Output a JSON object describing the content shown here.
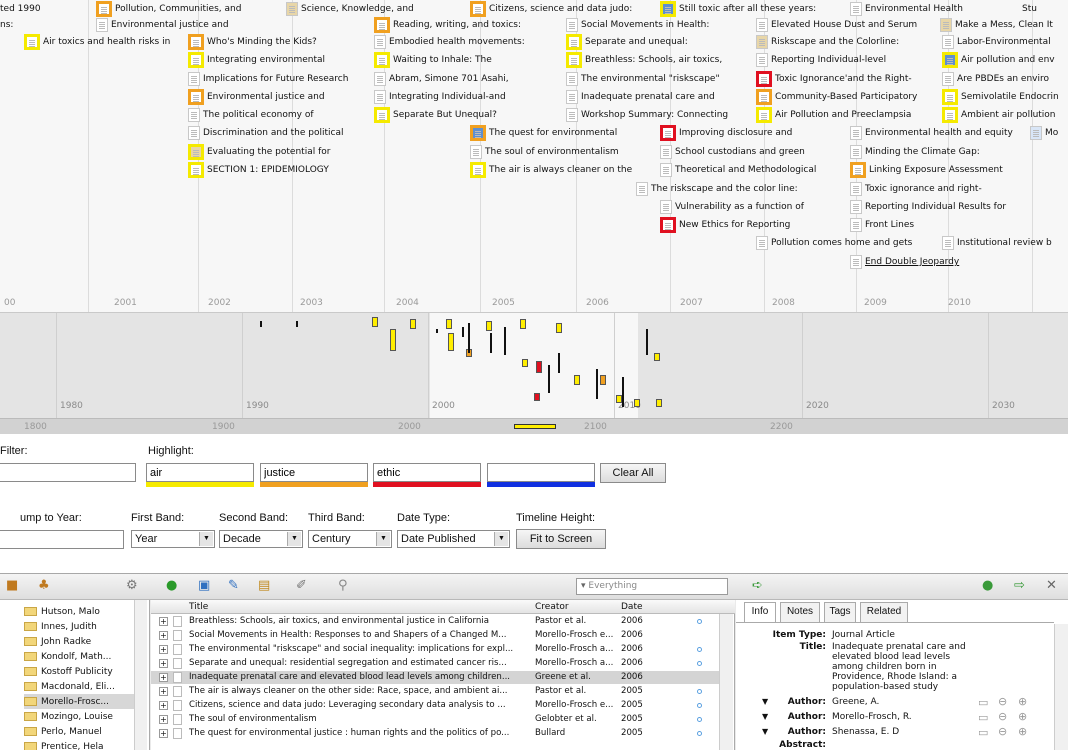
{
  "timeline": {
    "detail_years": [
      "00",
      "2001",
      "2002",
      "2003",
      "2004",
      "2005",
      "2006",
      "2007",
      "2008",
      "2009",
      "2010"
    ],
    "events": [
      {
        "label": "ted 1990",
        "h": "none",
        "k": "none"
      },
      {
        "label": "ns:",
        "h": "none",
        "k": "none"
      },
      {
        "label": "Air toxics and health risks in",
        "h": "air",
        "k": "doc"
      },
      {
        "label": "Pollution, Communities, and",
        "h": "just",
        "k": "doc"
      },
      {
        "label": "Environmental justice and",
        "h": "none",
        "k": "doc"
      },
      {
        "label": "Who's Minding the Kids?",
        "h": "just",
        "k": "doc"
      },
      {
        "label": "Integrating environmental",
        "h": "air",
        "k": "doc"
      },
      {
        "label": "Implications for Future Research",
        "h": "none",
        "k": "doc"
      },
      {
        "label": "Environmental justice and",
        "h": "just",
        "k": "doc"
      },
      {
        "label": "The political economy of",
        "h": "none",
        "k": "doc"
      },
      {
        "label": "Discrimination and the political",
        "h": "none",
        "k": "doc"
      },
      {
        "label": "Evaluating the potential for",
        "h": "air",
        "k": "img"
      },
      {
        "label": "SECTION 1: EPIDEMIOLOGY",
        "h": "air",
        "k": "doc"
      },
      {
        "label": "Science, Knowledge, and",
        "h": "none",
        "k": "img"
      },
      {
        "label": "Reading, writing, and toxics:",
        "h": "just",
        "k": "doc"
      },
      {
        "label": "Embodied health movements:",
        "h": "none",
        "k": "doc"
      },
      {
        "label": "Waiting to Inhale: The",
        "h": "air",
        "k": "doc"
      },
      {
        "label": "Abram, Simone 701 Asahi,",
        "h": "none",
        "k": "doc"
      },
      {
        "label": "Integrating Individual-and",
        "h": "none",
        "k": "doc"
      },
      {
        "label": "Separate But Unequal?",
        "h": "air",
        "k": "doc"
      },
      {
        "label": "Citizens, science and data judo:",
        "h": "just",
        "k": "doc"
      },
      {
        "label": "Social Movements in Health:",
        "h": "none",
        "k": "doc"
      },
      {
        "label": "Separate and unequal:",
        "h": "air",
        "k": "doc"
      },
      {
        "label": "Breathless: Schools, air toxics,",
        "h": "air",
        "k": "doc"
      },
      {
        "label": "The environmental \"riskscape\"",
        "h": "none",
        "k": "doc"
      },
      {
        "label": "Inadequate prenatal care and",
        "h": "none",
        "k": "doc"
      },
      {
        "label": "Workshop Summary: Connecting",
        "h": "none",
        "k": "doc"
      },
      {
        "label": "The quest for environmental",
        "h": "just",
        "k": "slide"
      },
      {
        "label": "The soul of environmentalism",
        "h": "none",
        "k": "doc"
      },
      {
        "label": "The air is always cleaner on the",
        "h": "air",
        "k": "doc"
      },
      {
        "label": "Still toxic after all these years:",
        "h": "air",
        "k": "slide"
      },
      {
        "label": "Elevated House Dust and Serum",
        "h": "none",
        "k": "doc"
      },
      {
        "label": "Riskscape and the Colorline:",
        "h": "none",
        "k": "img"
      },
      {
        "label": "Reporting Individual-level",
        "h": "none",
        "k": "doc"
      },
      {
        "label": "Toxic Ignorance'and the Right-",
        "h": "eth",
        "k": "doc"
      },
      {
        "label": "Community-Based Participatory",
        "h": "just",
        "k": "doc"
      },
      {
        "label": "Air Pollution and Preeclampsia",
        "h": "air",
        "k": "doc"
      },
      {
        "label": "Improving disclosure and",
        "h": "eth",
        "k": "doc"
      },
      {
        "label": "School custodians and green",
        "h": "none",
        "k": "doc"
      },
      {
        "label": "Theoretical and Methodological",
        "h": "none",
        "k": "doc"
      },
      {
        "label": "The riskscape and the color line:",
        "h": "none",
        "k": "doc"
      },
      {
        "label": "Vulnerability as a function of",
        "h": "none",
        "k": "doc"
      },
      {
        "label": "New Ethics for Reporting",
        "h": "eth",
        "k": "doc"
      },
      {
        "label": "Environmental Health",
        "h": "none",
        "k": "doc"
      },
      {
        "label": "Make a Mess, Clean It",
        "h": "none",
        "k": "img"
      },
      {
        "label": "Labor-Environmental",
        "h": "none",
        "k": "doc"
      },
      {
        "label": "Air pollution and env",
        "h": "air",
        "k": "slide"
      },
      {
        "label": "Are PBDEs an enviro",
        "h": "none",
        "k": "doc"
      },
      {
        "label": "Semivolatile Endocrin",
        "h": "air",
        "k": "doc"
      },
      {
        "label": "Ambient air pollution",
        "h": "air",
        "k": "doc"
      },
      {
        "label": "Environmental health and equity",
        "h": "none",
        "k": "doc"
      },
      {
        "label": "Minding the Climate Gap:",
        "h": "none",
        "k": "doc"
      },
      {
        "label": "Linking Exposure Assessment",
        "h": "just",
        "k": "doc"
      },
      {
        "label": "Toxic ignorance and right-",
        "h": "none",
        "k": "doc"
      },
      {
        "label": "Reporting Individual Results for",
        "h": "none",
        "k": "doc"
      },
      {
        "label": "Front Lines",
        "h": "none",
        "k": "doc"
      },
      {
        "label": "Pollution comes home and gets",
        "h": "none",
        "k": "doc"
      },
      {
        "label": "Institutional review b",
        "h": "none",
        "k": "doc"
      },
      {
        "label": "End Double Jeopardy",
        "h": "none",
        "k": "doc"
      },
      {
        "label": "Stu",
        "h": "air",
        "k": "none"
      },
      {
        "label": "Mo",
        "h": "none",
        "k": "book"
      }
    ],
    "overview_decades": [
      "1980",
      "1990",
      "2000",
      "2010",
      "2020",
      "2030"
    ],
    "centuries": [
      "1800",
      "1900",
      "2000",
      "2100",
      "2200"
    ]
  },
  "controls": {
    "filter_label": "Filter:",
    "highlight_label": "Highlight:",
    "highlights": [
      {
        "value": "air",
        "color": "#f5ea00"
      },
      {
        "value": "justice",
        "color": "#f0a020"
      },
      {
        "value": "ethic",
        "color": "#e01020"
      },
      {
        "value": "",
        "color": "#1030e0"
      }
    ],
    "clear_all": "Clear All",
    "jump_label": "ump to Year:",
    "first_band_label": "First Band:",
    "second_band_label": "Second Band:",
    "third_band_label": "Third Band:",
    "date_type_label": "Date Type:",
    "timeline_height_label": "Timeline Height:",
    "first_band": "Year",
    "second_band": "Decade",
    "third_band": "Century",
    "date_type": "Date Published",
    "fit_button": "Fit to Screen"
  },
  "zotero": {
    "search_placeholder": "Everything",
    "collections": [
      {
        "name": "Hutson, Malo",
        "selected": false
      },
      {
        "name": "Innes, Judith",
        "selected": false
      },
      {
        "name": "John Radke",
        "selected": false
      },
      {
        "name": "Kondolf, Math...",
        "selected": false
      },
      {
        "name": "Kostoff Publicity",
        "selected": false
      },
      {
        "name": "Macdonald, Eli...",
        "selected": false
      },
      {
        "name": "Morello-Frosc...",
        "selected": true
      },
      {
        "name": "Mozingo, Louise",
        "selected": false
      },
      {
        "name": "Perlo, Manuel",
        "selected": false
      },
      {
        "name": "Prentice, Hela",
        "selected": false
      }
    ],
    "columns": {
      "title": "Title",
      "creator": "Creator",
      "date": "Date"
    },
    "items": [
      {
        "title": "Breathless: Schools, air toxics, and environmental justice in California",
        "creator": "Pastor et al.",
        "date": "2006",
        "sel": false
      },
      {
        "title": "Social Movements in Health: Responses to and Shapers of a Changed M...",
        "creator": "Morello-Frosch e...",
        "date": "2006",
        "sel": false
      },
      {
        "title": "The environmental \"riskscape\" and social inequality: implications for expl...",
        "creator": "Morello-Frosch a...",
        "date": "2006",
        "sel": false
      },
      {
        "title": "Separate and unequal: residential segregation and estimated cancer ris...",
        "creator": "Morello-Frosch a...",
        "date": "2006",
        "sel": false
      },
      {
        "title": "Inadequate prenatal care and elevated blood lead levels among children...",
        "creator": "Greene et al.",
        "date": "2006",
        "sel": true
      },
      {
        "title": "The air is always cleaner on the other side: Race, space, and ambient ai...",
        "creator": "Pastor et al.",
        "date": "2005",
        "sel": false
      },
      {
        "title": "Citizens, science and data judo: Leveraging secondary data analysis to ...",
        "creator": "Morello-Frosch e...",
        "date": "2005",
        "sel": false
      },
      {
        "title": "The soul of environmentalism",
        "creator": "Gelobter et al.",
        "date": "2005",
        "sel": false
      },
      {
        "title": "The quest for environmental justice : human rights and the politics of po...",
        "creator": "Bullard",
        "date": "2005",
        "sel": false
      }
    ],
    "tabs": [
      "Info",
      "Notes",
      "Tags",
      "Related"
    ],
    "info": {
      "item_type_label": "Item Type:",
      "item_type": "Journal Article",
      "title_label": "Title:",
      "title": "Inadequate prenatal care and elevated blood lead levels among children born in Providence, Rhode Island: a population-based study",
      "author_label": "Author:",
      "authors": [
        "Greene, A.",
        "Morello-Frosch, R.",
        "Shenassa, E. D"
      ],
      "abstract_label": "Abstract:"
    }
  }
}
